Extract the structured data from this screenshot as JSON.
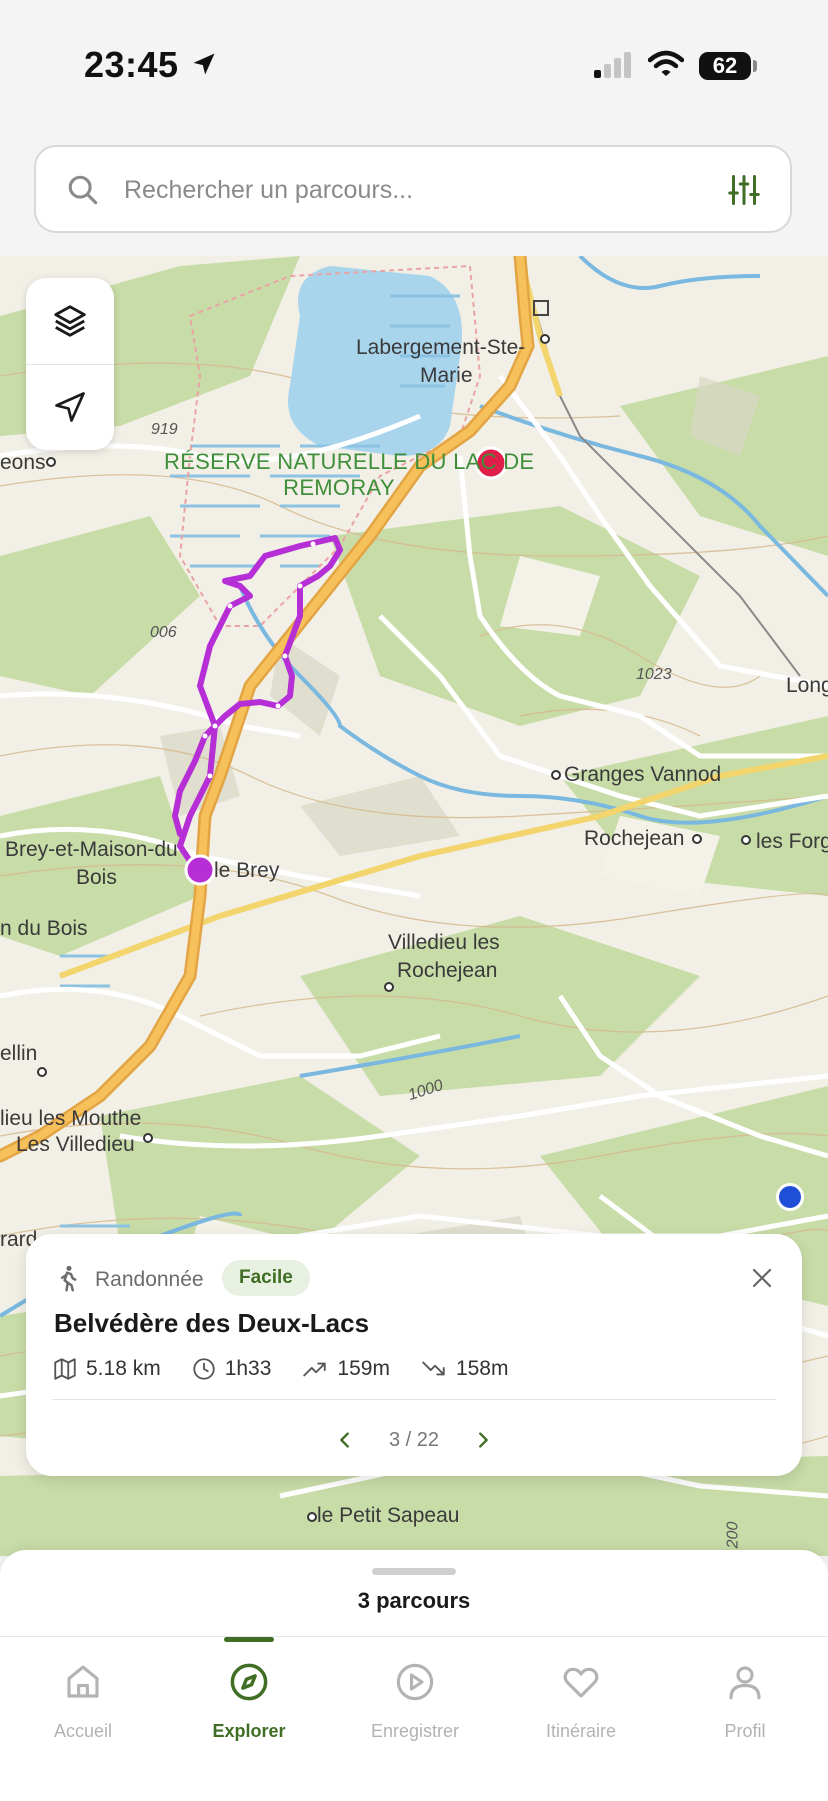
{
  "status_bar": {
    "time": "23:45",
    "battery": "62"
  },
  "search": {
    "placeholder": "Rechercher un parcours..."
  },
  "map": {
    "labels": {
      "labergement": "Labergement-Ste-",
      "marie": "Marie",
      "reserve_line1": "RÉSERVE NATURELLE DU LAC DE",
      "reserve_line2": "REMORAY",
      "eons": "eons",
      "alt_919": "919",
      "alt_006": "006",
      "alt_1023": "1023",
      "alt_1000": "1000",
      "alt_200": "200",
      "long": "Long",
      "granges": "Granges Vannod",
      "rochejean": "Rochejean",
      "forges": "les Forg",
      "brey_line1": "Brey-et-Maison-du",
      "brey_line2": "Bois",
      "le_brey": "le Brey",
      "n_du_bois": "n du Bois",
      "villedieu_line1": "Villedieu les",
      "villedieu_line2": "Rochejean",
      "ellin": "ellin",
      "mouthe_line1": "lieu les Mouthe",
      "mouthe_line2": "Les Villedieu",
      "rard": "rard",
      "petit_sapeau": "le Petit Sapeau"
    }
  },
  "route_card": {
    "activity": "Randonnée",
    "difficulty": "Facile",
    "title": "Belvédère des Deux-Lacs",
    "distance": "5.18 km",
    "duration": "1h33",
    "ascent": "159m",
    "descent": "158m",
    "pager": "3 / 22"
  },
  "sheet": {
    "count_label": "3 parcours"
  },
  "tabs": [
    {
      "label": "Accueil"
    },
    {
      "label": "Explorer"
    },
    {
      "label": "Enregistrer"
    },
    {
      "label": "Itinéraire"
    },
    {
      "label": "Profil"
    }
  ],
  "colors": {
    "accent": "#3f6e24",
    "route": "#b52ed6",
    "start_marker": "#e01e4a",
    "user_location": "#1f4fd6"
  }
}
